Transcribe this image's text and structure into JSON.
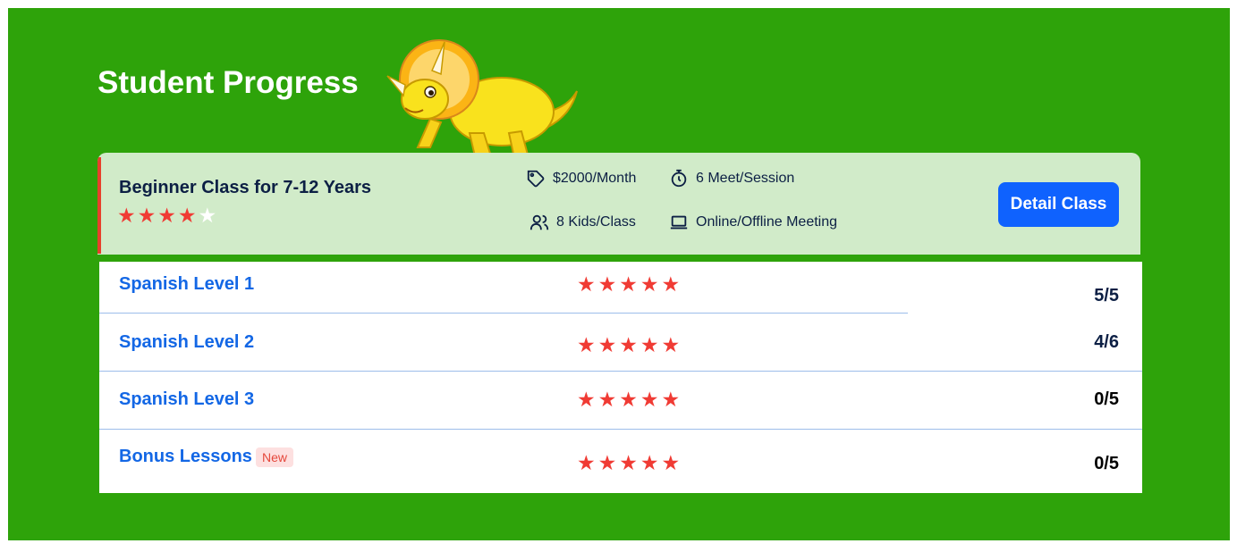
{
  "page": {
    "title": "Student Progress"
  },
  "class_card": {
    "name": "Beginner Class for 7-12 Years",
    "rating": 4,
    "rating_max": 5,
    "price": "$2000/Month",
    "sessions": "6 Meet/Session",
    "kids": "8 Kids/Class",
    "meeting": "Online/Offline Meeting",
    "detail_button": "Detail Class"
  },
  "lessons": [
    {
      "name": "Spanish Level 1",
      "score": "5/5"
    },
    {
      "name": "Spanish Level 2",
      "score": "4/6"
    },
    {
      "name": "Spanish Level 3",
      "score": "0/5"
    },
    {
      "name": "Bonus Lessons",
      "badge": "New",
      "score": "0/5"
    }
  ],
  "colors": {
    "panel": "#2ea30a",
    "accent": "#e8402c",
    "button": "#0f62fe",
    "star": "#f03b34",
    "link": "#1367e5"
  }
}
